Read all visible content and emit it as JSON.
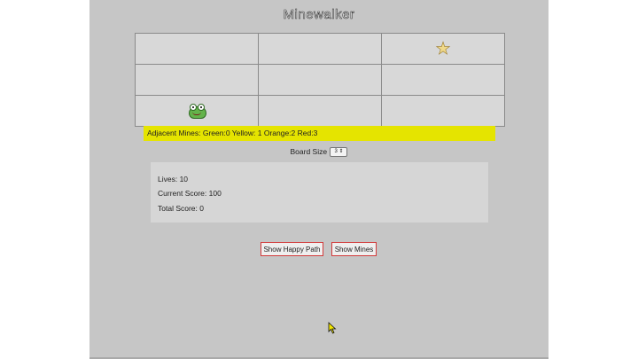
{
  "title": "Minewalker",
  "board": {
    "rows": [
      [
        {
          "item": ""
        },
        {
          "item": ""
        },
        {
          "item": "star-icon"
        }
      ],
      [
        {
          "item": ""
        },
        {
          "item": ""
        },
        {
          "item": ""
        }
      ],
      [
        {
          "item": "frog-icon"
        },
        {
          "item": ""
        },
        {
          "item": ""
        }
      ]
    ]
  },
  "adjacent_mines": "Adjacent Mines: Green:0 Yellow: 1 Orange:2 Red:3",
  "board_size": {
    "label": "Board Size",
    "value": "3"
  },
  "stats": {
    "lives": "Lives: 10",
    "current_score": "Current Score: 100",
    "total_score": "Total Score: 0"
  },
  "buttons": {
    "happy_path": "Show Happy Path",
    "show_mines": "Show Mines"
  },
  "colors": {
    "mines_bar": "#e5e400",
    "button_border": "#d13a3a",
    "panel": "#c6c6c6"
  }
}
